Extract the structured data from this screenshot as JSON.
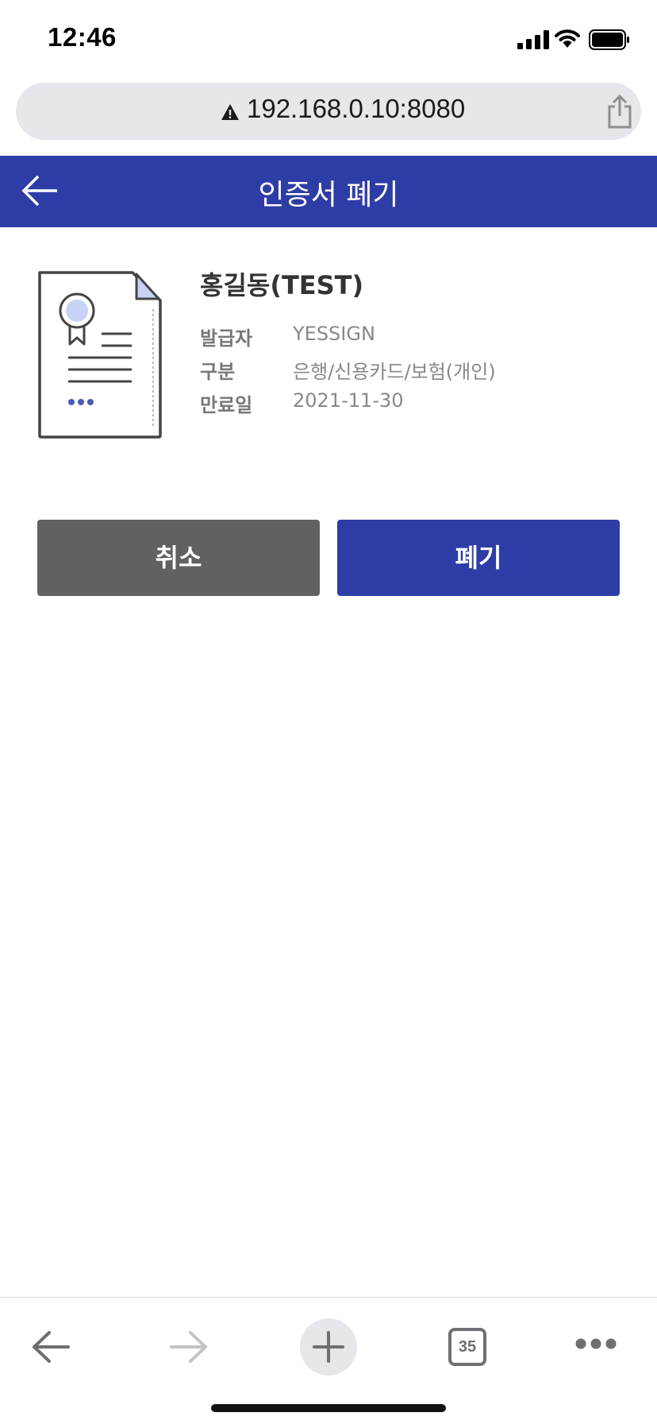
{
  "status_bar": {
    "time": "12:46"
  },
  "browser": {
    "url": "192.168.0.10:8080",
    "tab_count": "35"
  },
  "header": {
    "title": "인증서 폐기"
  },
  "certificate": {
    "name": "홍길동(TEST)",
    "rows": [
      {
        "label": "발급자",
        "value": "YESSIGN"
      },
      {
        "label": "구분",
        "value": "은행/신용카드/보험(개인)"
      },
      {
        "label": "만료일",
        "value": "2021-11-30"
      }
    ]
  },
  "buttons": {
    "cancel": "취소",
    "revoke": "폐기"
  },
  "colors": {
    "brand": "#2e3da6",
    "cancel_button": "#616161"
  },
  "icons": {
    "back": "arrow-left-icon",
    "certificate": "certificate-document-icon",
    "share": "share-icon",
    "warning": "warning-triangle-icon"
  }
}
